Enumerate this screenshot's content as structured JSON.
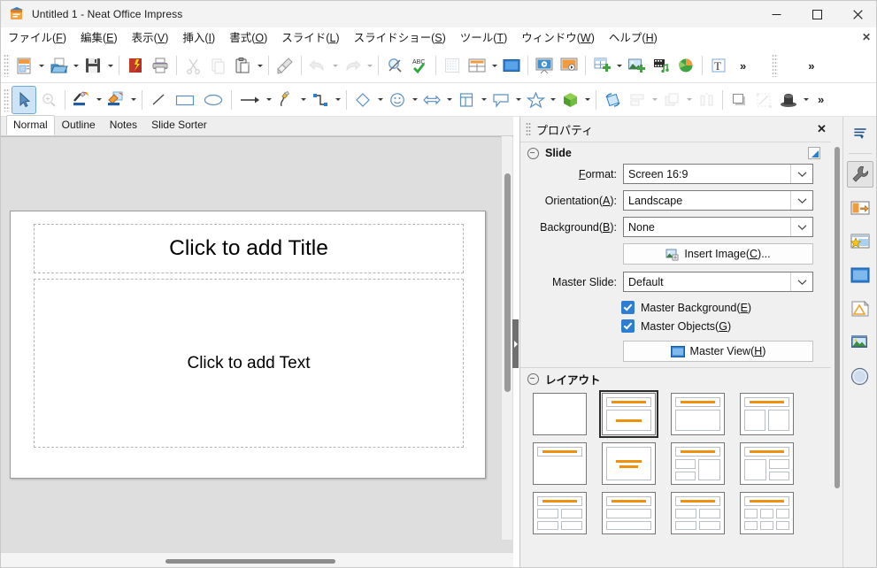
{
  "window": {
    "title": "Untitled 1 - Neat Office Impress",
    "app_icon": "impress-app-icon",
    "minimize": "–",
    "maximize": "□",
    "close": "✕"
  },
  "menubar": {
    "close_document": "✕",
    "items": [
      {
        "label": "ファイル(F)",
        "name": "menu-file"
      },
      {
        "label": "編集(E)",
        "name": "menu-edit"
      },
      {
        "label": "表示(V)",
        "name": "menu-view"
      },
      {
        "label": "挿入(I)",
        "name": "menu-insert"
      },
      {
        "label": "書式(O)",
        "name": "menu-format"
      },
      {
        "label": "スライド(L)",
        "name": "menu-slide"
      },
      {
        "label": "スライドショー(S)",
        "name": "menu-slideshow"
      },
      {
        "label": "ツール(T)",
        "name": "menu-tools"
      },
      {
        "label": "ウィンドウ(W)",
        "name": "menu-window"
      },
      {
        "label": "ヘルプ(H)",
        "name": "menu-help"
      }
    ]
  },
  "toolbar_standard": {
    "overflow": "»",
    "items": [
      {
        "name": "new-document-button",
        "icon": "new-document-icon"
      },
      {
        "name": "open-document-button",
        "icon": "open-folder-icon"
      },
      {
        "name": "save-button",
        "icon": "floppy-save-icon"
      },
      {
        "name": "export-pdf-button",
        "icon": "pdf-icon"
      },
      {
        "name": "print-button",
        "icon": "printer-icon"
      },
      {
        "name": "cut-button",
        "icon": "scissors-icon"
      },
      {
        "name": "copy-button",
        "icon": "copy-icon"
      },
      {
        "name": "paste-button",
        "icon": "clipboard-paste-icon"
      },
      {
        "name": "clone-formatting-button",
        "icon": "paintbrush-icon"
      },
      {
        "name": "undo-button",
        "icon": "undo-arrow-icon"
      },
      {
        "name": "redo-button",
        "icon": "redo-arrow-icon"
      },
      {
        "name": "find-replace-button",
        "icon": "magnifier-icon"
      },
      {
        "name": "spelling-button",
        "icon": "abc-check-icon"
      },
      {
        "name": "display-grid-button",
        "icon": "grid-icon"
      },
      {
        "name": "display-views-button",
        "icon": "table-views-icon"
      },
      {
        "name": "master-slide-button",
        "icon": "blue-slide-icon"
      },
      {
        "name": "start-from-first-slide-button",
        "icon": "presentation-play-icon"
      },
      {
        "name": "start-from-current-slide-button",
        "icon": "presentation-current-icon"
      },
      {
        "name": "insert-table-button",
        "icon": "insert-table-icon"
      },
      {
        "name": "insert-image-button",
        "icon": "insert-image-icon"
      },
      {
        "name": "insert-media-button",
        "icon": "insert-media-icon"
      },
      {
        "name": "insert-chart-button",
        "icon": "pie-chart-icon"
      },
      {
        "name": "insert-text-box-button",
        "icon": "text-box-icon"
      }
    ]
  },
  "toolbar_drawing": {
    "overflow": "»",
    "items": [
      {
        "name": "select-tool-button",
        "icon": "arrow-cursor-icon"
      },
      {
        "name": "zoom-tool-button",
        "icon": "zoom-magnifier-icon"
      },
      {
        "name": "line-color-button",
        "icon": "line-color-icon"
      },
      {
        "name": "fill-color-button",
        "icon": "fill-color-icon"
      },
      {
        "name": "insert-line-button",
        "icon": "line-icon"
      },
      {
        "name": "insert-rectangle-button",
        "icon": "rectangle-icon"
      },
      {
        "name": "insert-ellipse-button",
        "icon": "ellipse-icon"
      },
      {
        "name": "insert-arrow-button",
        "icon": "arrow-line-icon"
      },
      {
        "name": "curves-and-polygons-button",
        "icon": "curve-icon"
      },
      {
        "name": "connectors-button",
        "icon": "connector-icon"
      },
      {
        "name": "basic-shapes-button",
        "icon": "diamond-shape-icon"
      },
      {
        "name": "symbol-shapes-button",
        "icon": "smiley-icon"
      },
      {
        "name": "block-arrows-button",
        "icon": "block-arrow-icon"
      },
      {
        "name": "flowchart-button",
        "icon": "flowchart-icon"
      },
      {
        "name": "callouts-button",
        "icon": "callout-icon"
      },
      {
        "name": "stars-button",
        "icon": "star-icon"
      },
      {
        "name": "3d-objects-button",
        "icon": "green-cube-icon"
      },
      {
        "name": "rotate-button",
        "icon": "rotate-icon"
      },
      {
        "name": "align-objects-button",
        "icon": "align-icon"
      },
      {
        "name": "arrange-button",
        "icon": "arrange-icon"
      },
      {
        "name": "distribute-button",
        "icon": "distribute-icon"
      },
      {
        "name": "shadow-button",
        "icon": "shadow-icon"
      },
      {
        "name": "crop-image-button",
        "icon": "crop-icon"
      },
      {
        "name": "filter-button",
        "icon": "magic-hat-icon"
      }
    ]
  },
  "view_tabs": {
    "selected": "Normal",
    "items": [
      {
        "label": "Normal",
        "name": "tab-normal"
      },
      {
        "label": "Outline",
        "name": "tab-outline"
      },
      {
        "label": "Notes",
        "name": "tab-notes"
      },
      {
        "label": "Slide Sorter",
        "name": "tab-slide-sorter"
      }
    ]
  },
  "slide": {
    "title_placeholder": "Click to add Title",
    "body_placeholder": "Click to add Text"
  },
  "sidebar": {
    "title": "プロパティ",
    "close": "✕",
    "slide_panel": {
      "heading": "Slide",
      "format_label": "Format:",
      "format_value": "Screen 16:9",
      "orientation_label": "Orientation(A):",
      "orientation_value": "Landscape",
      "background_label": "Background(B):",
      "background_value": "None",
      "insert_image_button": "Insert Image(C)...",
      "master_slide_label": "Master Slide:",
      "master_slide_value": "Default",
      "master_background_checkbox": "Master Background(E)",
      "master_objects_checkbox": "Master Objects(G)",
      "master_view_button": "Master View(H)"
    },
    "layout_panel": {
      "heading": "レイアウト",
      "selected_index": 1,
      "layouts": [
        {
          "name": "layout-blank",
          "kind": "blank"
        },
        {
          "name": "layout-title-content",
          "kind": "title-centered-line"
        },
        {
          "name": "layout-title-body",
          "kind": "title-box"
        },
        {
          "name": "layout-two-content",
          "kind": "title-two-box"
        },
        {
          "name": "layout-title-only",
          "kind": "title-only"
        },
        {
          "name": "layout-centered-text",
          "kind": "centered-text"
        },
        {
          "name": "layout-two-content-left-split",
          "kind": "title-left-split"
        },
        {
          "name": "layout-two-content-right-split",
          "kind": "title-right-split"
        },
        {
          "name": "layout-four-content",
          "kind": "title-four"
        },
        {
          "name": "layout-stacked-content",
          "kind": "title-stacked"
        },
        {
          "name": "layout-two-by-two",
          "kind": "title-two-by-two"
        },
        {
          "name": "layout-six-content",
          "kind": "title-six"
        }
      ]
    },
    "rail": [
      {
        "name": "sidebar-settings-menu",
        "icon": "sidebar-menu-icon"
      },
      {
        "name": "sidebar-tab-properties",
        "icon": "wrench-icon",
        "active": true
      },
      {
        "name": "sidebar-tab-slide-transition",
        "icon": "slide-transition-icon"
      },
      {
        "name": "sidebar-tab-animation",
        "icon": "animation-star-icon"
      },
      {
        "name": "sidebar-tab-master-slides",
        "icon": "master-slides-icon"
      },
      {
        "name": "sidebar-tab-styles",
        "icon": "styles-icon"
      },
      {
        "name": "sidebar-tab-gallery",
        "icon": "gallery-icon"
      },
      {
        "name": "sidebar-tab-navigator",
        "icon": "navigator-compass-icon"
      }
    ]
  }
}
